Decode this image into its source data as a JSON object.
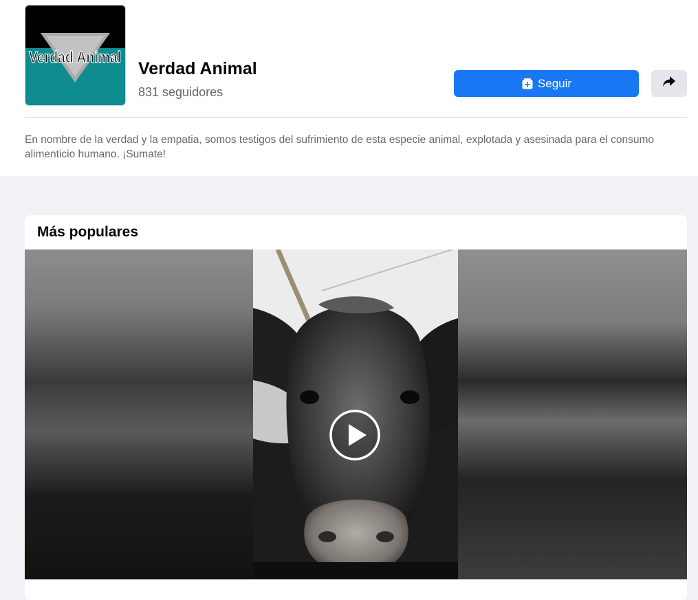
{
  "page": {
    "name": "Verdad Animal",
    "followers": "831 seguidores",
    "description": "En nombre de la verdad y la empatia, somos testigos del sufrimiento de esta especie animal, explotada y asesinada para el consumo alimenticio humano. ¡Sumate!",
    "logo_text": "Verdad Animal"
  },
  "actions": {
    "follow_label": "Seguir",
    "follow_icon": "follow-page-icon",
    "share_icon": "share-arrow-icon"
  },
  "popular": {
    "title": "Más populares",
    "play_icon": "play-icon"
  },
  "colors": {
    "primary": "#1877f2",
    "logo_teal": "#0f8c8f",
    "logo_black": "#000000",
    "page_bg": "#f0f2f5"
  }
}
